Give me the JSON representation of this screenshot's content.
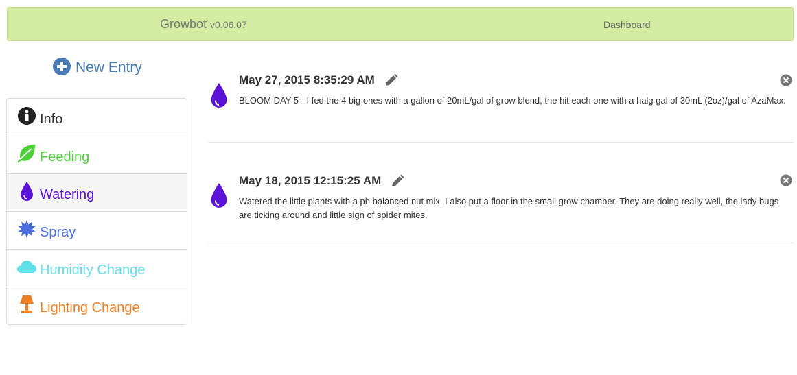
{
  "topbar": {
    "brand_name": "Growbot",
    "brand_version": "v0.06.07",
    "nav_dashboard": "Dashboard",
    "bg_color": "#d4eda3"
  },
  "new_entry": {
    "label": "New Entry",
    "icon": "plus-circle-icon",
    "color": "#4a7ab5"
  },
  "sidebar": {
    "items": [
      {
        "label": "Info",
        "icon": "info-circle-icon",
        "color": "#333333"
      },
      {
        "label": "Feeding",
        "icon": "leaf-icon",
        "color": "#4cd137"
      },
      {
        "label": "Watering",
        "icon": "water-drop-icon",
        "color": "#5b12d6",
        "active": true
      },
      {
        "label": "Spray",
        "icon": "burst-icon",
        "color": "#4a6ee0"
      },
      {
        "label": "Humidity Change",
        "icon": "cloud-icon",
        "color": "#5fe1ea"
      },
      {
        "label": "Lighting Change",
        "icon": "lamp-icon",
        "color": "#f07f22"
      }
    ]
  },
  "entries": [
    {
      "icon": "water-drop-icon",
      "timestamp": "May 27, 2015 8:35:29 AM",
      "text": "BLOOM DAY 5 - I fed the 4 big ones with a gallon of 20mL/gal of grow blend, the hit each one with a halg gal of 30mL (2oz)/gal of AzaMax."
    },
    {
      "icon": "water-drop-icon",
      "timestamp": "May 18, 2015 12:15:25 AM",
      "text": "Watered the little plants with a ph balanced nut mix. I also put a floor in the small grow chamber. They are doing really well, the lady bugs are ticking around and little sign of spider mites."
    }
  ]
}
